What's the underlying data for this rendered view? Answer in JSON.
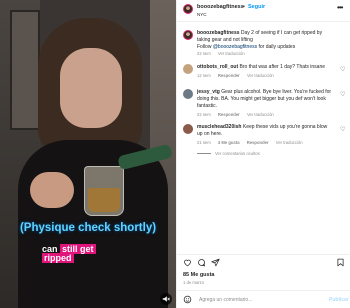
{
  "header": {
    "username": "booozebagfitness",
    "separator": "•",
    "follow_label": "Seguir",
    "location": "NYC",
    "more_icon": "more-horizontal-icon"
  },
  "caption": {
    "username": "booozebagfitness",
    "text": "Day 2 of seeing if I can get ripped by taking gear and not lifting",
    "follow_prefix": "Follow",
    "handle_link": "@booozebagfitness",
    "follow_suffix": "for daily updates",
    "time": "22 sem",
    "translation_label": "Ver traducción"
  },
  "comments": [
    {
      "username": "ottobots_roll_out",
      "text": "Bro that was after 1 day? Thats insane",
      "time": "12 sem",
      "reply_label": "Responder",
      "translation_label": "Ver traducción"
    },
    {
      "username": "jessy_vtg",
      "text": "Gear plus alcohol. Bye bye liver. You're fucked for doing this. BA. You might get bigger but you def won't look fantastic.",
      "time": "22 sem",
      "reply_label": "Responder",
      "translation_label": "Ver traducción"
    },
    {
      "username": "musclehead320ish",
      "text": "Keep these vids up you're gonna blow up on here.",
      "time": "21 sem",
      "likes_label": "3 Me gusta",
      "reply_label": "Responder",
      "translation_label": "Ver traducción"
    }
  ],
  "hidden_replies_label": "Ver comentarios ocultos",
  "video": {
    "caption_main": "(Physique check shortly)",
    "caption_line2_plain": "can ",
    "caption_line2_pink": "still get",
    "caption_line3_pink": "ripped"
  },
  "actions": {
    "like_icon": "heart-icon",
    "comment_icon": "comment-icon",
    "share_icon": "paper-plane-icon",
    "save_icon": "bookmark-icon"
  },
  "likes_count": "85 Me gusta",
  "post_date": "1 de marzo",
  "composer": {
    "emoji_icon": "smiley-icon",
    "placeholder": "Agrega un comentario...",
    "post_label": "Publicar"
  },
  "colors": {
    "accent": "#0095f6",
    "caption_blue": "#5fd4ff",
    "caption_pink": "#e0147b"
  }
}
